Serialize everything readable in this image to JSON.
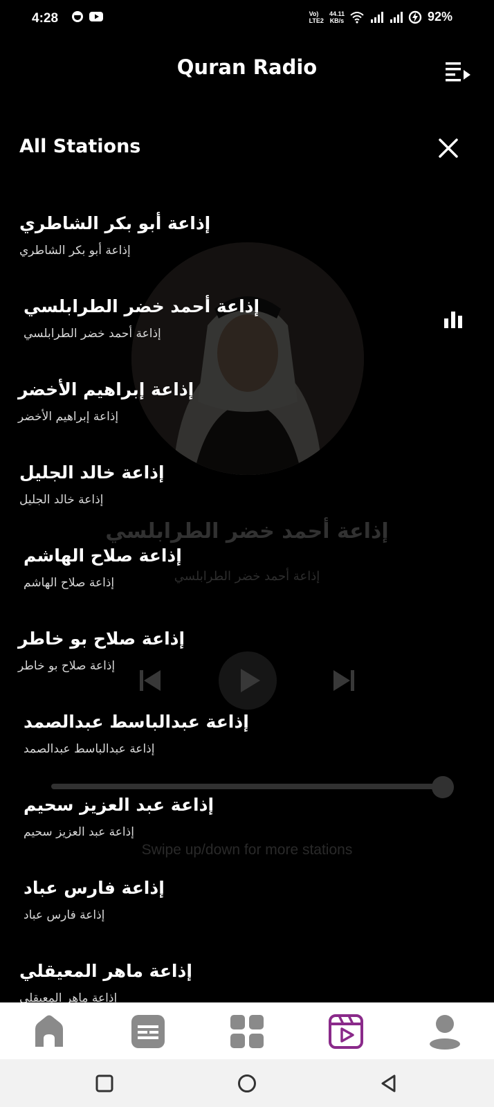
{
  "status_bar": {
    "time": "4:28",
    "volte": "Vo)",
    "lte": "LTE2",
    "net_speed_value": "44.11",
    "net_speed_unit": "KB/s",
    "battery": "92%"
  },
  "header": {
    "title": "Quran Radio",
    "queue_icon": "queue-music-icon"
  },
  "player": {
    "station_title": "إذاعة أحمد خضر الطرابلسي",
    "station_subtitle": "إذاعة أحمد خضر الطرابلسي",
    "hint": "Swipe up/down for more stations",
    "progress": 1.0
  },
  "stations_panel": {
    "title": "All Stations",
    "close_icon": "close-icon",
    "playing_index": 1,
    "stations": [
      {
        "name": "إذاعة أبو بكر الشاطري",
        "subtitle": "إذاعة أبو بكر الشاطري"
      },
      {
        "name": "إذاعة أحمد خضر الطرابلسي",
        "subtitle": "إذاعة أحمد خضر الطرابلسي"
      },
      {
        "name": "إذاعة إبراهيم الأخضر",
        "subtitle": "إذاعة إبراهيم الأخضر"
      },
      {
        "name": "إذاعة خالد الجليل",
        "subtitle": "إذاعة خالد الجليل"
      },
      {
        "name": "إذاعة صلاح الهاشم",
        "subtitle": "إذاعة صلاح الهاشم"
      },
      {
        "name": "إذاعة صلاح بو خاطر",
        "subtitle": "إذاعة صلاح بو خاطر"
      },
      {
        "name": "إذاعة عبدالباسط عبدالصمد",
        "subtitle": "إذاعة عبدالباسط عبدالصمد"
      },
      {
        "name": "إذاعة عبد العزيز سحيم",
        "subtitle": "إذاعة عبد العزيز سحيم"
      },
      {
        "name": "إذاعة فارس عباد",
        "subtitle": "إذاعة فارس عباد"
      },
      {
        "name": "إذاعة ماهر المعيقلي",
        "subtitle": "إذاعة ماهر المعيقلي"
      }
    ]
  },
  "bottom_nav": {
    "items": [
      {
        "icon": "home-icon"
      },
      {
        "icon": "article-icon"
      },
      {
        "icon": "grid-icon"
      },
      {
        "icon": "video-play-icon",
        "active": true
      },
      {
        "icon": "profile-icon"
      }
    ],
    "active_color": "#8a2a8a",
    "inactive_color": "#888888"
  }
}
